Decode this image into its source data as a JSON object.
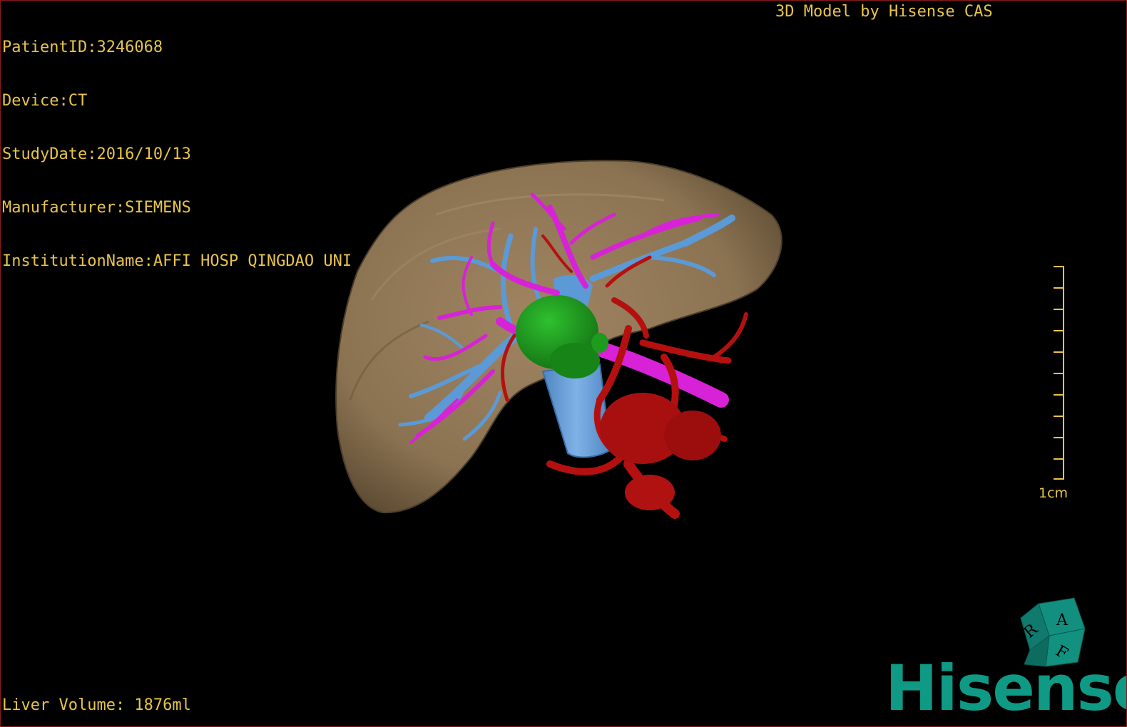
{
  "study_info": {
    "patient_id": "PatientID:3246068",
    "device": "Device:CT",
    "study_date": "StudyDate:2016/10/13",
    "manufacturer": "Manufacturer:SIEMENS",
    "institution": "InstitutionName:AFFI HOSP QINGDAO UNI"
  },
  "model_label": "3D Model by Hisense CAS",
  "liver_volume": "Liver Volume: 1876ml",
  "scale": {
    "label": "1cm"
  },
  "orientation_cube": {
    "faces": [
      "A",
      "R",
      "F"
    ]
  },
  "brand": "Hisense",
  "colors": {
    "text": "#e8c44a",
    "liver": "#8b7352",
    "hepatic_vein": "#d722d7",
    "portal_vein": "#5b9ad6",
    "artery": "#b51010",
    "tumor": "#1e9a1e",
    "brand": "#0f9a86",
    "frame": "#8a1a1a"
  }
}
